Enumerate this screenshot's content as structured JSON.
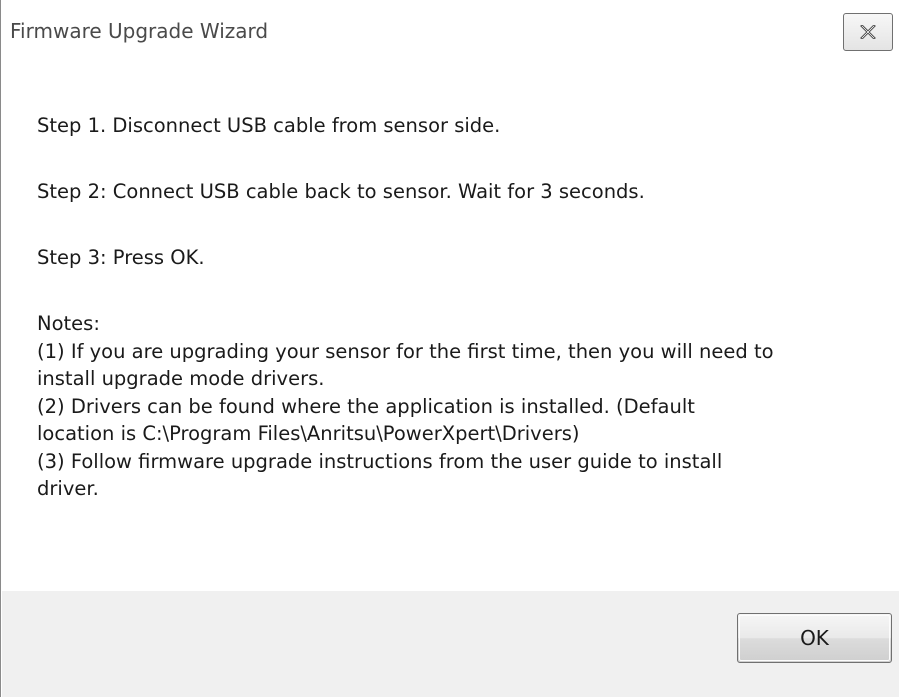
{
  "window": {
    "title": "Firmware Upgrade Wizard",
    "close_icon": "close-icon"
  },
  "instructions": {
    "step1": "Step 1. Disconnect USB cable from sensor side.",
    "step2": "Step 2: Connect USB cable back to sensor. Wait for 3 seconds.",
    "step3": "Step 3: Press OK.",
    "notes_heading": "Notes:",
    "notes_lines": [
      "(1) If you are upgrading your sensor for the first time, then you will need to",
      "install upgrade mode drivers.",
      "(2) Drivers can be found where the application is installed. (Default",
      "location is C:\\Program Files\\Anritsu\\PowerXpert\\Drivers)",
      "(3) Follow firmware upgrade instructions from the user guide to install",
      "driver."
    ]
  },
  "footer": {
    "ok_label": "OK"
  },
  "colors": {
    "footer_background": "#f0f0f0",
    "text": "#1a1a1a",
    "title_text": "#4a4a4a"
  }
}
